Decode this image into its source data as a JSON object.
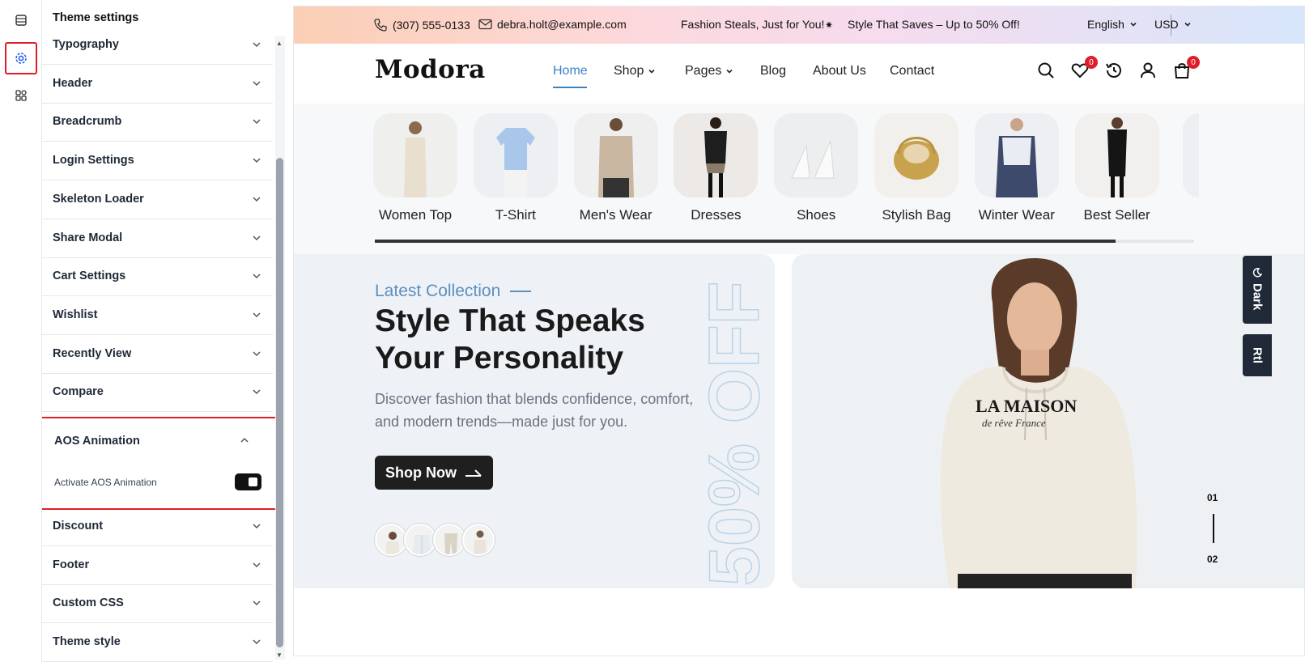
{
  "sidebar_rail": {
    "icons": [
      "list-icon",
      "gear-icon",
      "widgets-icon"
    ]
  },
  "settings": {
    "title": "Theme settings",
    "sections_top": [
      {
        "label": "Typography"
      },
      {
        "label": "Header"
      },
      {
        "label": "Breadcrumb"
      },
      {
        "label": "Login Settings"
      },
      {
        "label": "Skeleton Loader"
      },
      {
        "label": "Share Modal"
      },
      {
        "label": "Cart Settings"
      },
      {
        "label": "Wishlist"
      },
      {
        "label": "Recently View"
      },
      {
        "label": "Compare"
      }
    ],
    "aos": {
      "label": "AOS Animation",
      "option_label": "Activate AOS Animation",
      "option_enabled": true
    },
    "sections_bottom": [
      {
        "label": "Discount"
      },
      {
        "label": "Footer"
      },
      {
        "label": "Custom CSS"
      },
      {
        "label": "Theme style"
      }
    ]
  },
  "site": {
    "topbar": {
      "phone": "(307) 555-0133",
      "email": "debra.holt@example.com",
      "promo_1": "Fashion Steals, Just for You!",
      "promo_separator": "✷",
      "promo_2": "Style That Saves – Up to 50% Off!",
      "language": "English",
      "currency": "USD"
    },
    "nav": {
      "logo": "Modora",
      "links": [
        {
          "label": "Home",
          "active": true
        },
        {
          "label": "Shop",
          "has_dropdown": true
        },
        {
          "label": "Pages",
          "has_dropdown": true
        },
        {
          "label": "Blog"
        },
        {
          "label": "About Us"
        },
        {
          "label": "Contact"
        }
      ],
      "wishlist_count": "0",
      "cart_count": "0"
    },
    "categories": [
      {
        "label": "Women Top"
      },
      {
        "label": "T-Shirt"
      },
      {
        "label": "Men's Wear"
      },
      {
        "label": "Dresses"
      },
      {
        "label": "Shoes"
      },
      {
        "label": "Stylish Bag"
      },
      {
        "label": "Winter Wear"
      },
      {
        "label": "Best Seller"
      }
    ],
    "hero": {
      "kicker": "Latest Collection",
      "headline": "Style That Speaks Your Personality",
      "description": "Discover fashion that blends confidence, comfort, and modern trends—made just for you.",
      "cta": "Shop Now",
      "discount_outline": "50% OFF",
      "slide_current": "01",
      "slide_next": "02",
      "sweatshirt_text_1": "LA MAISON",
      "sweatshirt_text_2": "de rêve France"
    },
    "side_tabs": {
      "dark": "Dark",
      "rtl": "Rtl"
    },
    "colors": {
      "accent": "#3b82c4",
      "badge": "#e11d2a",
      "highlight_border": "#e11d2a"
    }
  }
}
